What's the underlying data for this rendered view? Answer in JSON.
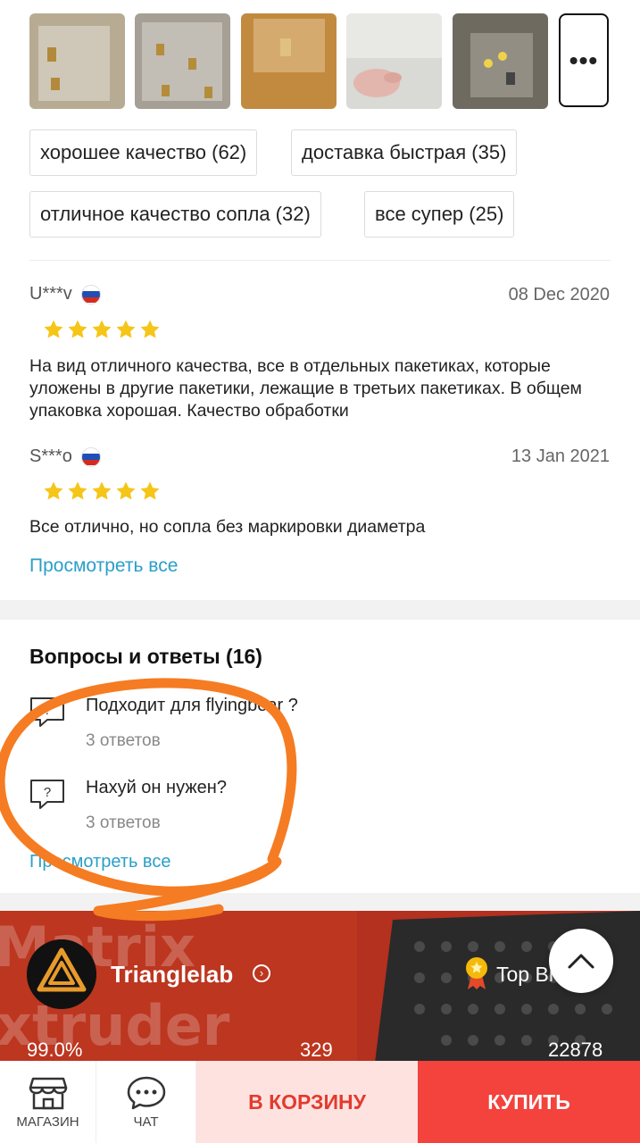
{
  "gallery": {
    "more_label": "•••",
    "thumbnails": [
      {
        "icon": "photo-nozzles-bag"
      },
      {
        "icon": "photo-nozzles-bag"
      },
      {
        "icon": "photo-nozzle-on-table"
      },
      {
        "icon": "photo-hand-holding"
      },
      {
        "icon": "photo-nozzles-package"
      }
    ]
  },
  "tags": [
    "хорошее качество (62)",
    "доставка быстрая (35)",
    "отличное качество сопла (32)",
    "все супер (25)"
  ],
  "reviews": [
    {
      "user": "U***v",
      "flag": "russia-flag-icon",
      "date": "08 Dec 2020",
      "rating": 5,
      "text": "На вид отличного качества, все в отдельных пакетиках, которые уложены в другие пакетики, лежащие в третьих пакетиках. В общем упаковка хорошая. Качество обработки"
    },
    {
      "user": "S***o",
      "flag": "russia-flag-icon",
      "date": "13 Jan 2021",
      "rating": 5,
      "text": "Все отлично, но сопла без маркировки диаметра"
    }
  ],
  "reviews_view_all": "Просмотреть все",
  "qa": {
    "title": "Вопросы и ответы (16)",
    "items": [
      {
        "question": "Подходит для flyingbear ?",
        "answers": "3 ответов"
      },
      {
        "question": "Нахуй он нужен?",
        "answers": "3 ответов"
      }
    ],
    "view_all": "Просмотреть все"
  },
  "store": {
    "name": "Trianglelab",
    "badge": "Top Brands",
    "background_text": [
      "Matrix",
      "xtruder"
    ],
    "stats": [
      "99.0%",
      "329",
      "22878"
    ]
  },
  "bottom_bar": {
    "shop_label": "МАГАЗИН",
    "chat_label": "ЧАТ",
    "cart_label": "В КОРЗИНУ",
    "buy_label": "КУПИТЬ"
  },
  "colors": {
    "link": "#2a9fc9",
    "star": "#f5c518",
    "buy": "#f4423c",
    "cart_bg": "#fde2e0",
    "annotation": "#f57c22"
  }
}
